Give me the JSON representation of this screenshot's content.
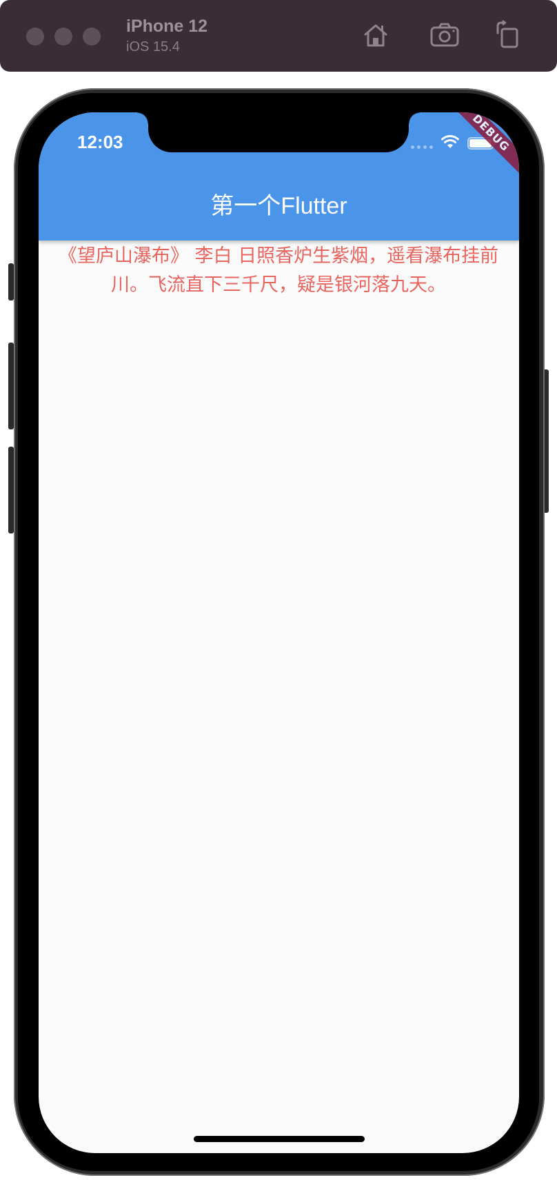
{
  "simulator": {
    "device_name": "iPhone 12",
    "os_version": "iOS 15.4",
    "toolbar_icons": [
      "home-icon",
      "screenshot-icon",
      "rotate-icon"
    ]
  },
  "status_bar": {
    "time": "12:03",
    "icons": [
      "signal-icon",
      "wifi-icon",
      "battery-icon"
    ]
  },
  "app_bar": {
    "title": "第一个Flutter",
    "color": "#4a94ea"
  },
  "debug_banner": {
    "label": "DEBUG",
    "color": "#8b1a3b"
  },
  "body": {
    "text": "《望庐山瀑布》 李白 日照香炉生紫烟，遥看瀑布挂前川。飞流直下三千尺，疑是银河落九天。",
    "text_color": "#e8655f"
  }
}
